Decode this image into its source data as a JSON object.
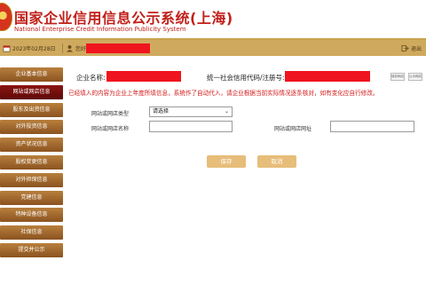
{
  "header": {
    "title_cn": "国家企业信用信息公示系统(上海)",
    "title_en": "National Enterprise Credit Information Publicity System"
  },
  "topbar": {
    "date": "2023年02月28日",
    "user_label": "您好",
    "right_link": "退出"
  },
  "sidebar": {
    "items": [
      {
        "label": "企业基本信息",
        "active": false
      },
      {
        "label": "网站或网店信息",
        "active": true
      },
      {
        "label": "股东及出资信息",
        "active": false
      },
      {
        "label": "对外投资信息",
        "active": false
      },
      {
        "label": "资产状况信息",
        "active": false
      },
      {
        "label": "股权变更信息",
        "active": false
      },
      {
        "label": "对外担保信息",
        "active": false
      },
      {
        "label": "党建信息",
        "active": false
      },
      {
        "label": "特种设备信息",
        "active": false
      },
      {
        "label": "社保信息",
        "active": false
      },
      {
        "label": "提交并公示",
        "active": false
      }
    ]
  },
  "main": {
    "company_name_label": "企业名称:",
    "credit_code_label": "统一社会信用代码/注册号:",
    "mini_buttons": [
      "保存网店",
      "公示网店"
    ],
    "notice": "已经填入的内容为企业上年度所填信息，系统作了自动代入，请企业根据当前实际情况逐条核对，如有变化应自行修改。",
    "form": {
      "type_label": "网站或网店类型",
      "type_value": "请选择",
      "name_label": "网站或网店名称",
      "url_label": "网站或网店网址"
    },
    "save_button": "保存",
    "cancel_button": "取消"
  },
  "colors": {
    "brand_red": "#c0201a",
    "gold_bar": "#cfaa5e",
    "sidebar_brown": "#a8702f",
    "sidebar_active": "#7a1210",
    "redaction": "#f0141e",
    "button_tan": "#e7bd7a"
  },
  "icons": {
    "emblem": "national-emblem-icon",
    "calendar": "calendar-icon",
    "user": "user-icon",
    "logout": "logout-icon"
  }
}
